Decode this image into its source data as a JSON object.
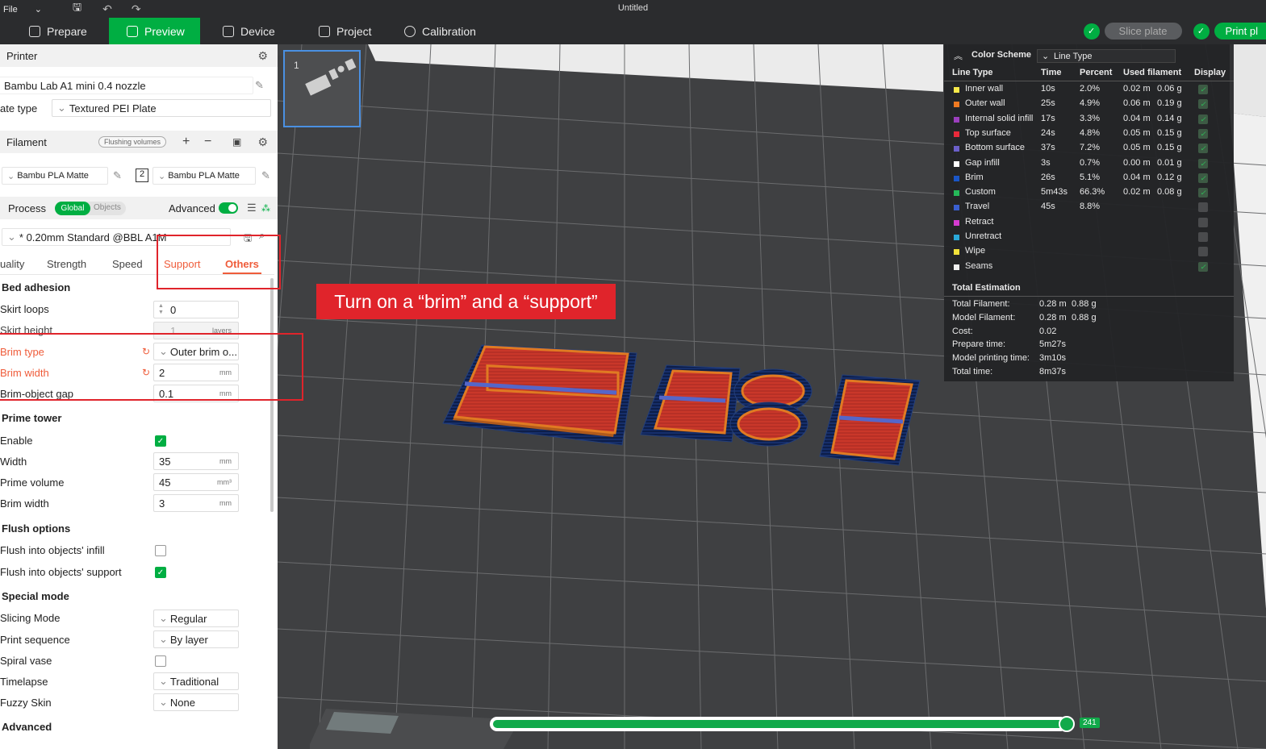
{
  "window": {
    "title": "Untitled",
    "menu_file": "File"
  },
  "tabs": [
    {
      "label": "Prepare",
      "icon": "cube-icon"
    },
    {
      "label": "Preview",
      "icon": "layers-icon"
    },
    {
      "label": "Device",
      "icon": "device-icon"
    },
    {
      "label": "Project",
      "icon": "project-icon"
    },
    {
      "label": "Calibration",
      "icon": "calibration-icon"
    }
  ],
  "toolbar": {
    "slice_plate": "Slice plate",
    "print_plate": "Print pl"
  },
  "printer": {
    "section_title": "Printer",
    "name": "Bambu Lab A1 mini 0.4 nozzle",
    "plate_type_label": "ate type",
    "plate_type_value": "Textured PEI Plate"
  },
  "filament": {
    "section_title": "Filament",
    "flushing_volumes": "Flushing volumes",
    "slot1_name": "Bambu PLA Matte",
    "slot2_number": "2",
    "slot2_name": "Bambu PLA Matte"
  },
  "process": {
    "section_title": "Process",
    "global": "Global",
    "objects": "Objects",
    "advanced_label": "Advanced",
    "preset": "* 0.20mm Standard @BBL A1M",
    "tabs": [
      "uality",
      "Strength",
      "Speed",
      "Support",
      "Others"
    ]
  },
  "settings": {
    "bed_adhesion": "Bed adhesion",
    "skirt_loops_label": "Skirt loops",
    "skirt_loops_value": "0",
    "skirt_height_label": "Skirt height",
    "skirt_height_value": "1",
    "skirt_height_unit": "layers",
    "brim_type_label": "Brim type",
    "brim_type_value": "Outer brim o...",
    "brim_width_label": "Brim width",
    "brim_width_value": "2",
    "brim_gap_label": "Brim-object gap",
    "brim_gap_value": "0.1",
    "unit_mm": "mm",
    "unit_mm3": "mm³",
    "prime_tower": "Prime tower",
    "enable_label": "Enable",
    "width_label": "Width",
    "width_value": "35",
    "prime_volume_label": "Prime volume",
    "prime_volume_value": "45",
    "pt_brim_width_label": "Brim width",
    "pt_brim_width_value": "3",
    "flush_options": "Flush options",
    "flush_infill_label": "Flush into objects' infill",
    "flush_support_label": "Flush into objects' support",
    "special_mode": "Special mode",
    "slicing_mode_label": "Slicing Mode",
    "slicing_mode_value": "Regular",
    "print_sequence_label": "Print sequence",
    "print_sequence_value": "By layer",
    "spiral_vase_label": "Spiral vase",
    "timelapse_label": "Timelapse",
    "timelapse_value": "Traditional",
    "fuzzy_skin_label": "Fuzzy Skin",
    "fuzzy_skin_value": "None",
    "advanced": "Advanced"
  },
  "annotation": "Turn on a “brim” and a “support”",
  "legend": {
    "color_scheme_label": "Color Scheme",
    "color_scheme_value": "Line Type",
    "headers": [
      "Line Type",
      "Time",
      "Percent",
      "Used filament",
      "Display"
    ],
    "rows": [
      {
        "name": "Inner wall",
        "color": "#f7e94a",
        "time": "10s",
        "percent": "2.0%",
        "length": "0.02 m",
        "weight": "0.06 g",
        "display": true
      },
      {
        "name": "Outer wall",
        "color": "#f07a22",
        "time": "25s",
        "percent": "4.9%",
        "length": "0.06 m",
        "weight": "0.19 g",
        "display": true
      },
      {
        "name": "Internal solid infill",
        "color": "#9b3fbd",
        "time": "17s",
        "percent": "3.3%",
        "length": "0.04 m",
        "weight": "0.14 g",
        "display": true
      },
      {
        "name": "Top surface",
        "color": "#e8293a",
        "time": "24s",
        "percent": "4.8%",
        "length": "0.05 m",
        "weight": "0.15 g",
        "display": true
      },
      {
        "name": "Bottom surface",
        "color": "#6b5fc9",
        "time": "37s",
        "percent": "7.2%",
        "length": "0.05 m",
        "weight": "0.15 g",
        "display": true
      },
      {
        "name": "Gap infill",
        "color": "#ffffff",
        "time": "3s",
        "percent": "0.7%",
        "length": "0.00 m",
        "weight": "0.01 g",
        "display": true
      },
      {
        "name": "Brim",
        "color": "#1a56c7",
        "time": "26s",
        "percent": "5.1%",
        "length": "0.04 m",
        "weight": "0.12 g",
        "display": true
      },
      {
        "name": "Custom",
        "color": "#25b858",
        "time": "5m43s",
        "percent": "66.3%",
        "length": "0.02 m",
        "weight": "0.08 g",
        "display": true
      },
      {
        "name": "Travel",
        "color": "#3a5fd0",
        "time": "45s",
        "percent": "8.8%",
        "length": "",
        "weight": "",
        "display": false
      },
      {
        "name": "Retract",
        "color": "#d53bd0",
        "time": "",
        "percent": "",
        "length": "",
        "weight": "",
        "display": false
      },
      {
        "name": "Unretract",
        "color": "#2aa8d8",
        "time": "",
        "percent": "",
        "length": "",
        "weight": "",
        "display": false
      },
      {
        "name": "Wipe",
        "color": "#f2e23a",
        "time": "",
        "percent": "",
        "length": "",
        "weight": "",
        "display": false
      },
      {
        "name": "Seams",
        "color": "#f0f0f0",
        "time": "",
        "percent": "",
        "length": "",
        "weight": "",
        "display": true
      }
    ],
    "total_title": "Total Estimation",
    "totals": [
      {
        "label": "Total Filament:",
        "v1": "0.28 m",
        "v2": "0.88 g"
      },
      {
        "label": "Model Filament:",
        "v1": "0.28 m",
        "v2": "0.88 g"
      },
      {
        "label": "Cost:",
        "v1": "0.02",
        "v2": ""
      },
      {
        "label": "Prepare time:",
        "v1": "5m27s",
        "v2": ""
      },
      {
        "label": "Model printing time:",
        "v1": "3m10s",
        "v2": ""
      },
      {
        "label": "Total time:",
        "v1": "8m37s",
        "v2": ""
      }
    ]
  },
  "preview": {
    "plate_number": "1",
    "layer_slider_value": "241",
    "layer_progress": 1.0
  }
}
